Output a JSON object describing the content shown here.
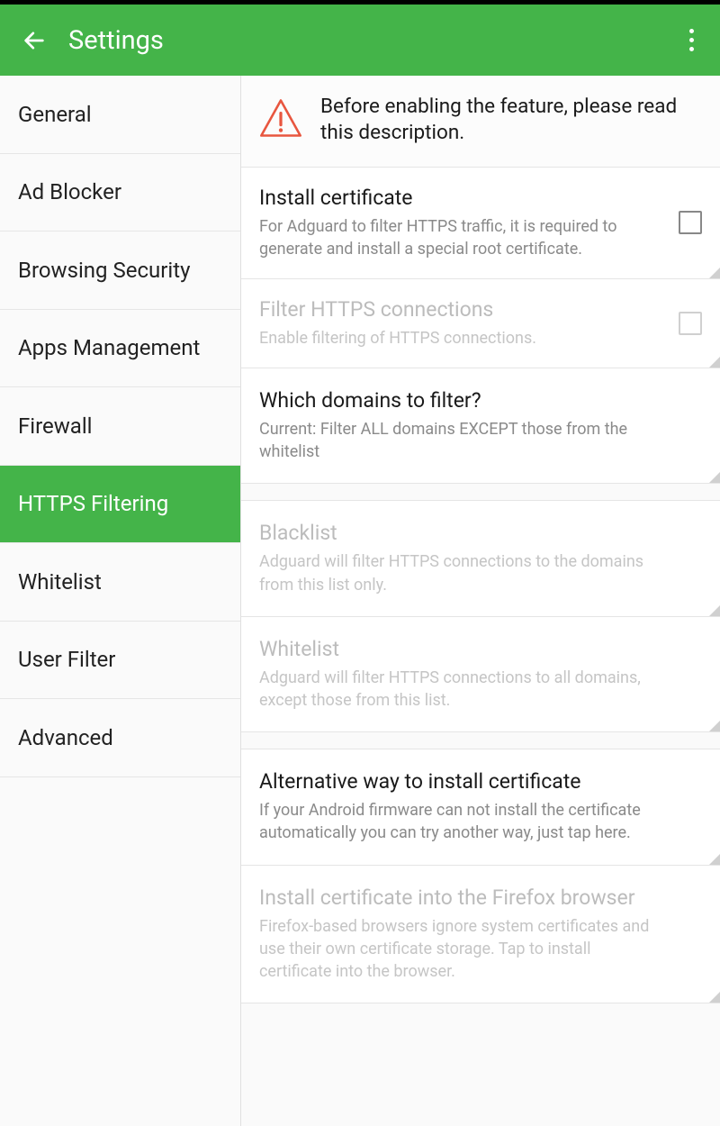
{
  "header": {
    "title": "Settings"
  },
  "sidebar": {
    "items": [
      {
        "label": "General"
      },
      {
        "label": "Ad Blocker"
      },
      {
        "label": "Browsing Security"
      },
      {
        "label": "Apps Management"
      },
      {
        "label": "Firewall"
      },
      {
        "label": "HTTPS Filtering"
      },
      {
        "label": "Whitelist"
      },
      {
        "label": "User Filter"
      },
      {
        "label": "Advanced"
      }
    ],
    "selected": "HTTPS Filtering"
  },
  "banner": {
    "text": "Before enabling the feature, please read this description."
  },
  "settings": [
    {
      "key": "install_cert",
      "title": "Install certificate",
      "desc": "For Adguard to filter HTTPS traffic, it is required to generate and install a special root certificate.",
      "checkbox": true,
      "disabled": false
    },
    {
      "key": "filter_https",
      "title": "Filter HTTPS connections",
      "desc": "Enable filtering of HTTPS connections.",
      "checkbox": true,
      "disabled": true
    },
    {
      "key": "which_domains",
      "title": "Which domains to filter?",
      "desc": "Current: Filter ALL domains EXCEPT those from the whitelist",
      "checkbox": false,
      "disabled": false
    },
    {
      "key": "blacklist",
      "title": "Blacklist",
      "desc": "Adguard will filter HTTPS connections to the domains from this list only.",
      "checkbox": false,
      "disabled": true
    },
    {
      "key": "whitelist",
      "title": "Whitelist",
      "desc": "Adguard will filter HTTPS connections to all domains, except those from this list.",
      "checkbox": false,
      "disabled": true
    },
    {
      "key": "alt_install",
      "title": "Alternative way to install certificate",
      "desc": "If your Android firmware can not install the certificate automatically you can try another way, just tap here.",
      "checkbox": false,
      "disabled": false
    },
    {
      "key": "firefox_install",
      "title": "Install certificate into the Firefox browser",
      "desc": "Firefox-based browsers ignore system certificates and use their own certificate storage. Tap to install certificate into the browser.",
      "checkbox": false,
      "disabled": true
    }
  ]
}
